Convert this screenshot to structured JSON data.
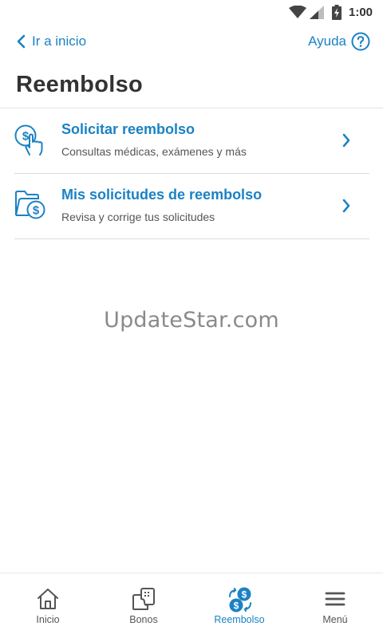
{
  "status_bar": {
    "time": "1:00"
  },
  "topnav": {
    "back_label": "Ir a inicio",
    "help_label": "Ayuda"
  },
  "page": {
    "title": "Reembolso"
  },
  "menu": [
    {
      "title": "Solicitar reembolso",
      "subtitle": "Consultas médicas, exámenes y más",
      "icon": "hand-dollar-icon"
    },
    {
      "title": "Mis solicitudes de reembolso",
      "subtitle": "Revisa y corrige tus solicitudes",
      "icon": "folder-dollar-icon"
    }
  ],
  "watermark": "UpdateStar.com",
  "bottom_nav": [
    {
      "label": "Inicio",
      "icon": "home-icon",
      "active": false
    },
    {
      "label": "Bonos",
      "icon": "bonus-ticket-icon",
      "active": false
    },
    {
      "label": "Reembolso",
      "icon": "reimbursement-icon",
      "active": true
    },
    {
      "label": "Menú",
      "icon": "hamburger-icon",
      "active": false
    }
  ],
  "colors": {
    "accent": "#1b82c4",
    "text": "#333333",
    "muted": "#555555",
    "divider": "#dcdcdc"
  }
}
